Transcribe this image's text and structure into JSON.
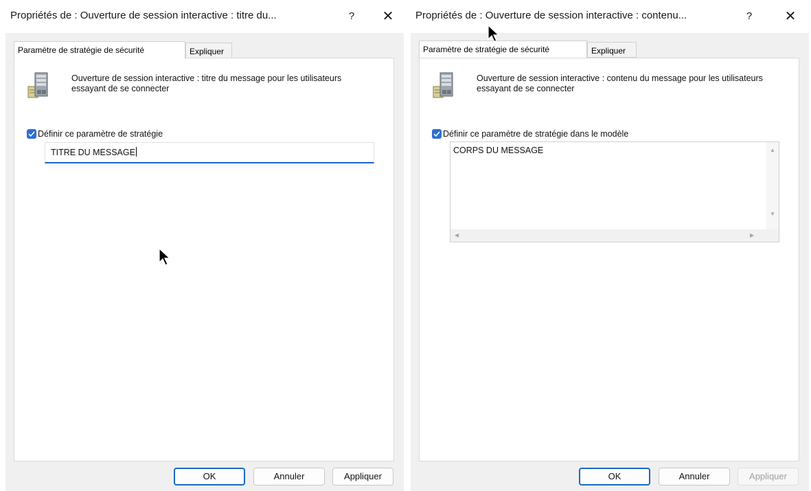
{
  "left_dialog": {
    "title": "Propriétés de : Ouverture de session interactive : titre du...",
    "help_symbol": "?",
    "close_symbol": "✕",
    "tabs": [
      {
        "label": "Paramètre de stratégie de sécurité",
        "active": true
      },
      {
        "label": "Expliquer",
        "active": false
      }
    ],
    "icon": "server-icon",
    "policy_description": "Ouverture de session interactive : titre du message pour les utilisateurs essayant de se connecter",
    "checkbox_checked": true,
    "checkbox_label": "Définir ce paramètre de stratégie",
    "field_value": "TITRE DU MESSAGE",
    "buttons": {
      "ok": "OK",
      "cancel": "Annuler",
      "apply": "Appliquer"
    },
    "apply_enabled": true
  },
  "right_dialog": {
    "title": "Propriétés de : Ouverture de session interactive : contenu...",
    "help_symbol": "?",
    "close_symbol": "✕",
    "tabs": [
      {
        "label": "Paramètre de stratégie de sécurité",
        "active": true
      },
      {
        "label": "Expliquer",
        "active": false
      }
    ],
    "icon": "server-icon",
    "policy_description": "Ouverture de session interactive : contenu du message pour les utilisateurs essayant de se connecter",
    "checkbox_checked": true,
    "checkbox_label": "Définir ce paramètre de stratégie dans le modèle",
    "field_value": "CORPS DU MESSAGE",
    "buttons": {
      "ok": "OK",
      "cancel": "Annuler",
      "apply": "Appliquer"
    },
    "apply_enabled": false
  },
  "colors": {
    "accent": "#1767c8",
    "checkbox": "#2f6fd1",
    "dialog_bg": "#f0f0f0",
    "disabled_text": "#a0a0a0"
  }
}
